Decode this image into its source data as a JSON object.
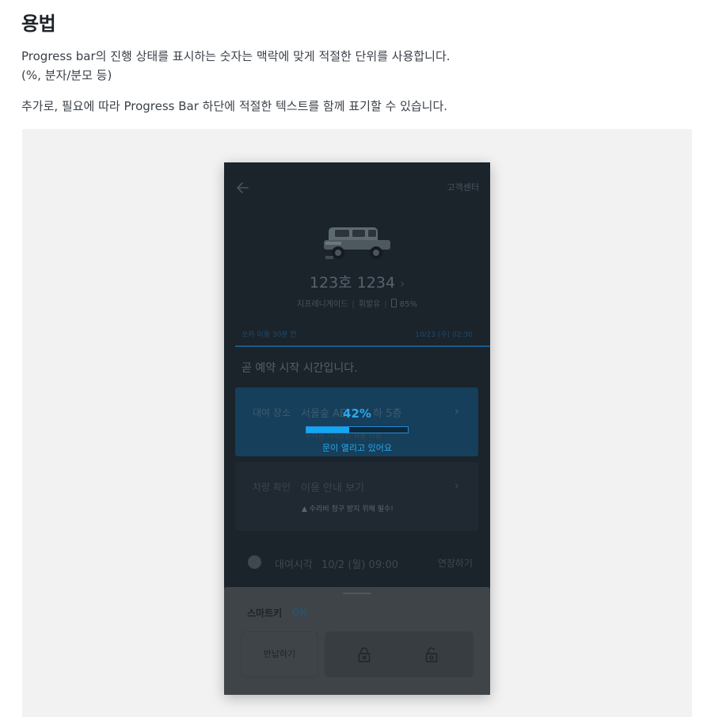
{
  "doc": {
    "title": "용법",
    "para1": "Progress bar의 진행 상태를 표시하는 숫자는 맥락에 맞게 적절한 단위를 사용합니다.",
    "para1b": "(%, 분자/분모 등)",
    "para2": "추가로, 필요에 따라 Progress Bar 하단에 적절한 텍스트를 함께 표기할 수 있습니다."
  },
  "phone": {
    "help_link": "고객센터",
    "plate": "123호 1234",
    "plate_chevron": "›",
    "car_model": "지프레니게이드",
    "fuel": "휘발유",
    "battery": "85%",
    "status_left": "쏘카 이용 30분 전",
    "status_right": "10/23 (수) 02:30",
    "notice": "곧 예약 시작 시간입니다.",
    "rent_card": {
      "label": "대여 장소",
      "value": "서울숲 AE",
      "value_tail": "하 5층",
      "chevron": "›",
      "sub": "주차권 지하5층 사용 가능"
    },
    "check_card": {
      "label": "차량 확인",
      "value": "이용 안내 보기",
      "chevron": "›",
      "sub": "▲ 수리비 청구 방지 위해 필수!"
    },
    "progress": {
      "percent_text": "42%",
      "value": 0.42,
      "caption": "문이 열리고 있어요"
    },
    "time_row": {
      "label": "대여시각",
      "value": "10/2 (월) 09:00",
      "extend": "연장하기"
    },
    "smartkey": {
      "title": "스마트키",
      "state": "ON",
      "return_label": "반납하기"
    }
  },
  "colors": {
    "accent": "#0fa8f5",
    "phone_bg": "#1b232b",
    "frame_bg": "#f2f2f2"
  }
}
